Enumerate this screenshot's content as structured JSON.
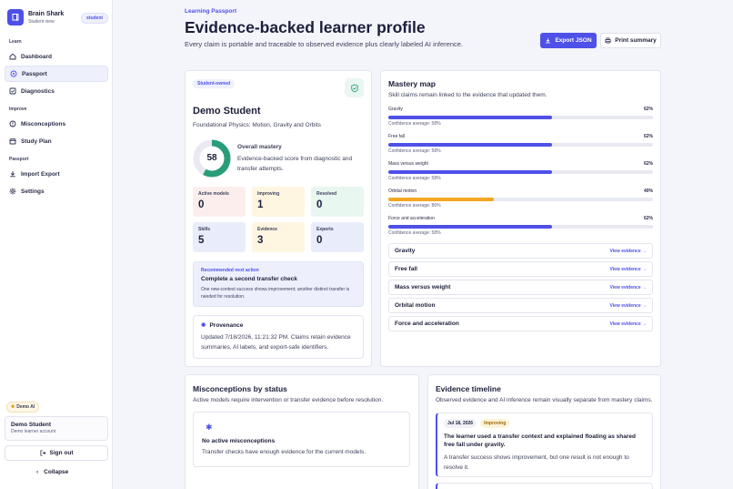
{
  "brand": {
    "title": "Brain Shark",
    "subtitle": "Student view",
    "role": "student"
  },
  "nav": {
    "learn_label": "Learn",
    "learn": [
      {
        "label": "Dashboard",
        "icon": "home-icon"
      },
      {
        "label": "Passport",
        "icon": "passport-icon",
        "active": true
      },
      {
        "label": "Diagnostics",
        "icon": "diagnostics-icon"
      }
    ],
    "improve_label": "Improve",
    "improve": [
      {
        "label": "Misconceptions",
        "icon": "misconceptions-icon"
      },
      {
        "label": "Study Plan",
        "icon": "calendar-icon"
      }
    ],
    "passport_label": "Passport",
    "passport": [
      {
        "label": "Import Export",
        "icon": "import-icon"
      },
      {
        "label": "Settings",
        "icon": "gear-icon"
      }
    ]
  },
  "demo_chip": "Demo AI",
  "user": {
    "name": "Demo Student",
    "subtitle": "Demo learner account"
  },
  "signout_label": "Sign out",
  "collapse_label": "Collapse",
  "header": {
    "eyebrow": "Learning Passport",
    "title": "Evidence-backed learner profile",
    "subtitle": "Every claim is portable and traceable to observed evidence plus clearly labeled AI inference.",
    "export_label": "Export JSON",
    "print_label": "Print summary"
  },
  "profile": {
    "owned_pill": "Student-owned",
    "name": "Demo Student",
    "course": "Foundational Physics: Motion, Gravity and Orbits",
    "mastery_value": "58",
    "mastery_fraction": 0.58,
    "mastery_label": "Overall mastery",
    "mastery_desc": "Evidence-backed score from diagnostic and transfer attempts."
  },
  "stats": [
    {
      "label": "Active models",
      "value": "0",
      "bg": "#fdeeee"
    },
    {
      "label": "Improving",
      "value": "1",
      "bg": "#fff6e2"
    },
    {
      "label": "Resolved",
      "value": "0",
      "bg": "#e8f7ef"
    },
    {
      "label": "Skills",
      "value": "5",
      "bg": "#e9edfb"
    },
    {
      "label": "Evidence",
      "value": "3",
      "bg": "#fff6e2"
    },
    {
      "label": "Exports",
      "value": "0",
      "bg": "#e9edfb"
    }
  ],
  "next_action": {
    "eyebrow": "Recommended next action",
    "title": "Complete a second transfer check",
    "desc": "One new-context success shows improvement; another distinct transfer is needed for resolution."
  },
  "provenance": {
    "title": "Provenance",
    "desc": "Updated 7/18/2026, 11:21:32 PM. Claims retain evidence summaries, AI labels, and export-safe identifiers."
  },
  "mastery_map": {
    "title": "Mastery map",
    "subtitle": "Skill claims remain linked to the evidence that updated them.",
    "skills": [
      {
        "name": "Gravity",
        "pct_label": "62%",
        "value": 0.62,
        "conf": "Confidence average: 58%",
        "color": "#4e50e8"
      },
      {
        "name": "Free fall",
        "pct_label": "62%",
        "value": 0.62,
        "conf": "Confidence average: 58%",
        "color": "#4e50e8"
      },
      {
        "name": "Mass versus weight",
        "pct_label": "62%",
        "value": 0.62,
        "conf": "Confidence average: 58%",
        "color": "#4e50e8"
      },
      {
        "name": "Orbital motion",
        "pct_label": "40%",
        "value": 0.4,
        "conf": "Confidence average: 86%",
        "color": "#f5a623"
      },
      {
        "name": "Force and acceleration",
        "pct_label": "62%",
        "value": 0.62,
        "conf": "Confidence average: 58%",
        "color": "#4e50e8"
      }
    ],
    "evidence_link_label": "View evidence →"
  },
  "misconceptions": {
    "title": "Misconceptions by status",
    "subtitle": "Active models require intervention or transfer evidence before resolution.",
    "empty_title": "No active misconceptions",
    "empty_desc": "Transfer checks have enough evidence for the current models."
  },
  "timeline": {
    "title": "Evidence timeline",
    "subtitle": "Observed evidence and AI inference remain visually separate from mastery claims.",
    "items": [
      {
        "date": "Jul 18, 2026",
        "badge": "Improving",
        "title": "The learner used a transfer context and explained floating as shared free fall under gravity.",
        "desc": "A transfer success shows improvement, but one result is not enough to resolve it."
      }
    ]
  },
  "colors": {
    "accent": "#4e50e8",
    "warn": "#f5a623",
    "success": "#2a9d78"
  }
}
